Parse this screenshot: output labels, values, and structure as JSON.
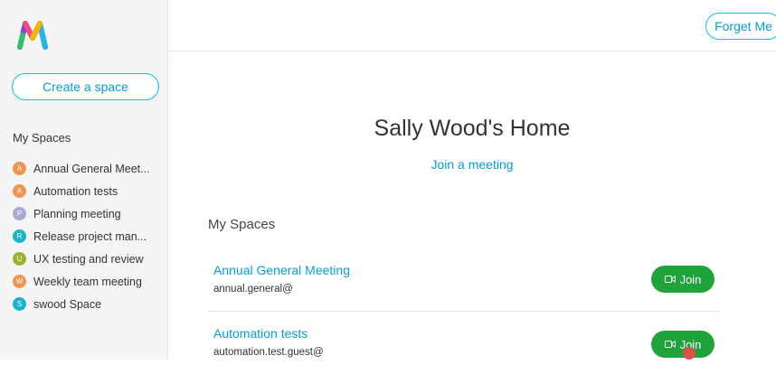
{
  "sidebar": {
    "create_label": "Create a space",
    "heading": "My Spaces",
    "items": [
      {
        "initial": "A",
        "label": "Annual General Meet...",
        "color": "#f0944f"
      },
      {
        "initial": "A",
        "label": "Automation tests",
        "color": "#f0944f"
      },
      {
        "initial": "P",
        "label": "Planning meeting",
        "color": "#a9a9d6"
      },
      {
        "initial": "R",
        "label": "Release project man...",
        "color": "#19b4c9"
      },
      {
        "initial": "U",
        "label": "UX testing and review",
        "color": "#9fb02f"
      },
      {
        "initial": "W",
        "label": "Weekly team meeting",
        "color": "#f0944f"
      },
      {
        "initial": "S",
        "label": "swood Space",
        "color": "#19b4c9"
      }
    ]
  },
  "header": {
    "forget_label": "Forget Me"
  },
  "main": {
    "title": "Sally Wood's Home",
    "join_meeting_label": "Join a meeting",
    "spaces_heading": "My Spaces",
    "spaces": [
      {
        "name": "Annual General Meeting",
        "address": "annual.general@",
        "join_label": "Join"
      },
      {
        "name": "Automation tests",
        "address": "automation.test.guest@",
        "join_label": "Join"
      }
    ]
  },
  "colors": {
    "accent": "#049fd9",
    "join_green": "#1fa33b"
  }
}
